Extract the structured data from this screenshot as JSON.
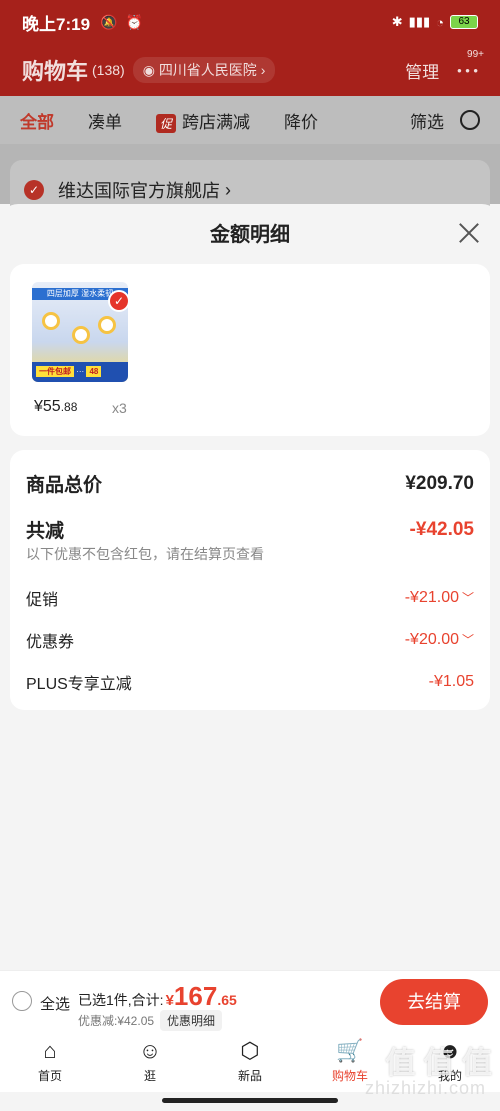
{
  "status_bar": {
    "time": "晚上7:19",
    "battery": "63"
  },
  "cart_header": {
    "title": "购物车",
    "count": "(138)",
    "location": "四川省人民医院",
    "manage": "管理",
    "more_badge": "99+"
  },
  "tabs": [
    {
      "label": "全部",
      "active": true
    },
    {
      "label": "凑单"
    },
    {
      "label": "跨店满减",
      "tag": "促"
    },
    {
      "label": "降价"
    }
  ],
  "filter_label": "筛选",
  "store": {
    "name": "维达国际官方旗舰店"
  },
  "sheet": {
    "title": "金额明细",
    "product": {
      "img_band": "四层加厚 湿水柔韧",
      "img_promo": "一件包邮",
      "img_price": "48",
      "price_main": "¥55",
      "price_dec": ".88",
      "qty": "x3"
    },
    "summary": {
      "goods_total_label": "商品总价",
      "goods_total_value": "¥209.70",
      "discount_label": "共减",
      "discount_value": "-¥42.05",
      "discount_note": "以下优惠不包含红包，请在结算页查看",
      "promo_label": "促销",
      "promo_value": "-¥21.00",
      "coupon_label": "优惠券",
      "coupon_value": "-¥20.00",
      "plus_label": "PLUS专享立减",
      "plus_value": "-¥1.05"
    }
  },
  "action_bar": {
    "select_all": "全选",
    "selected_text": "已选1件,合计:",
    "total_currency": "¥",
    "total_int": "167",
    "total_dec": ".65",
    "saved_text": "优惠减:¥42.05",
    "detail_label": "优惠明细",
    "checkout_label": "去结算"
  },
  "nav": [
    {
      "label": "首页",
      "icon": "home-icon"
    },
    {
      "label": "逛",
      "icon": "explore-icon"
    },
    {
      "label": "新品",
      "icon": "box-icon"
    },
    {
      "label": "购物车",
      "icon": "cart-icon",
      "active": true
    },
    {
      "label": "我的",
      "icon": "profile-icon"
    }
  ],
  "watermark": {
    "main": "值 值 值",
    "sub": "zhizhizhi.com"
  },
  "colors": {
    "brand": "#e8432f",
    "header": "#a6211b"
  }
}
